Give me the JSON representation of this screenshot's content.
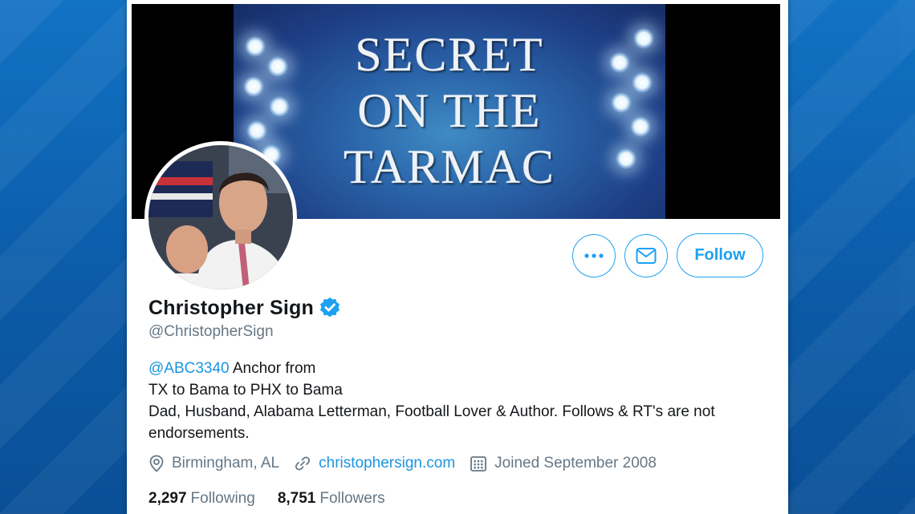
{
  "banner": {
    "lines": [
      "SECRET",
      "ON THE",
      "TARMAC"
    ]
  },
  "profile": {
    "name": "Christopher Sign",
    "handle": "@ChristopherSign",
    "bio": {
      "mention": "@ABC3340",
      "line1_rest": " Anchor from",
      "line2": "TX to Bama to PHX to Bama",
      "line3": "Dad, Husband, Alabama Letterman, Football Lover & Author. Follows & RT's are not endorsements."
    },
    "location": "Birmingham, AL",
    "website": "christophersign.com",
    "joined": "Joined September 2008",
    "following_count": "2,297",
    "following_label": "Following",
    "followers_count": "8,751",
    "followers_label": "Followers"
  },
  "actions": {
    "follow_label": "Follow"
  },
  "icons": {
    "more": "more-icon",
    "message": "envelope-icon",
    "verified": "verified-badge-icon",
    "location": "location-pin-icon",
    "link": "link-icon",
    "calendar": "calendar-icon"
  },
  "colors": {
    "accent": "#1da1f2",
    "link": "#1b95e0",
    "muted": "#657786",
    "text": "#14171a",
    "backdrop": "#0b5ba8"
  }
}
